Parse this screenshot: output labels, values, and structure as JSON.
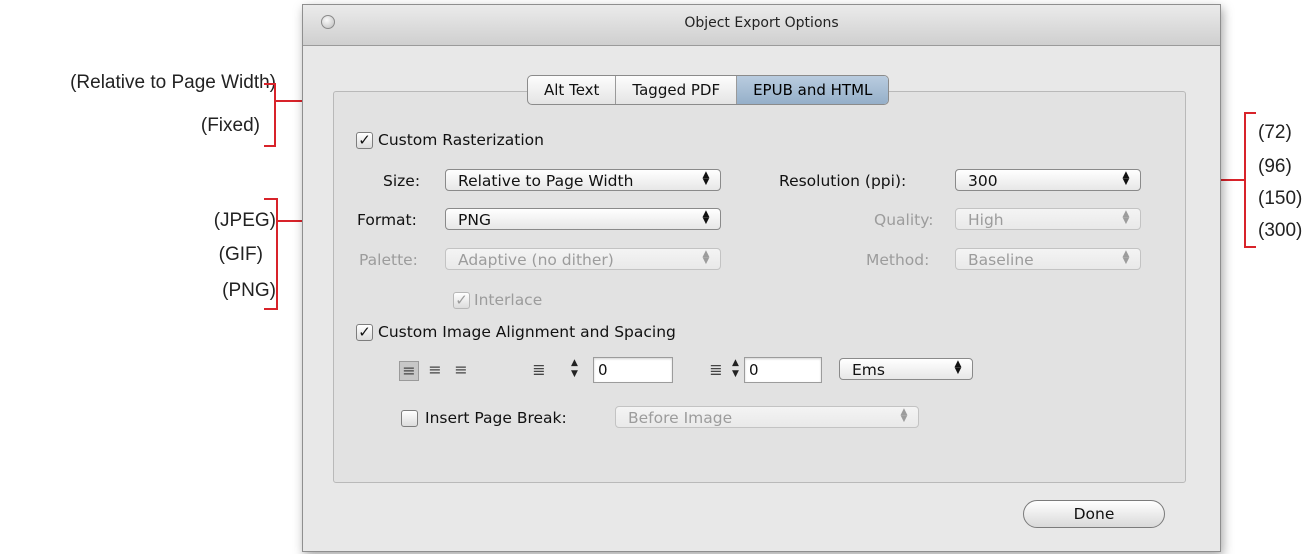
{
  "annotations": {
    "size_options": [
      "(Relative to Page Width)",
      "(Fixed)"
    ],
    "format_options": [
      "(JPEG)",
      "(GIF)",
      "(PNG)"
    ],
    "resolution_options": [
      "(72)",
      "(96)",
      "(150)",
      "(300)"
    ]
  },
  "colors": {
    "annotation_bracket": "#d8232a",
    "active_tab": "#a8bdd3",
    "window_bg": "#e8e8e8"
  },
  "window": {
    "title": "Object Export Options"
  },
  "tabs": [
    {
      "label": "Alt Text",
      "active": false
    },
    {
      "label": "Tagged PDF",
      "active": false
    },
    {
      "label": "EPUB and HTML",
      "active": true
    }
  ],
  "rasterization": {
    "checkbox_label": "Custom Rasterization",
    "checked": true,
    "size_label": "Size:",
    "size_value": "Relative to Page Width",
    "format_label": "Format:",
    "format_value": "PNG",
    "palette_label": "Palette:",
    "palette_value": "Adaptive (no dither)",
    "interlace_label": "Interlace",
    "resolution_label": "Resolution (ppi):",
    "resolution_value": "300",
    "quality_label": "Quality:",
    "quality_value": "High",
    "method_label": "Method:",
    "method_value": "Baseline"
  },
  "alignment": {
    "checkbox_label": "Custom Image Alignment and Spacing",
    "checked": true,
    "space_before_value": "0",
    "space_after_value": "0",
    "units_value": "Ems",
    "page_break_label": "Insert Page Break:",
    "page_break_checked": false,
    "page_break_value": "Before Image"
  },
  "icons": [
    "align-left-icon",
    "align-center-icon",
    "align-right-icon",
    "space-before-icon",
    "space-after-icon",
    "checkmark-icon",
    "updown-arrows-icon"
  ],
  "footer": {
    "done_label": "Done"
  }
}
